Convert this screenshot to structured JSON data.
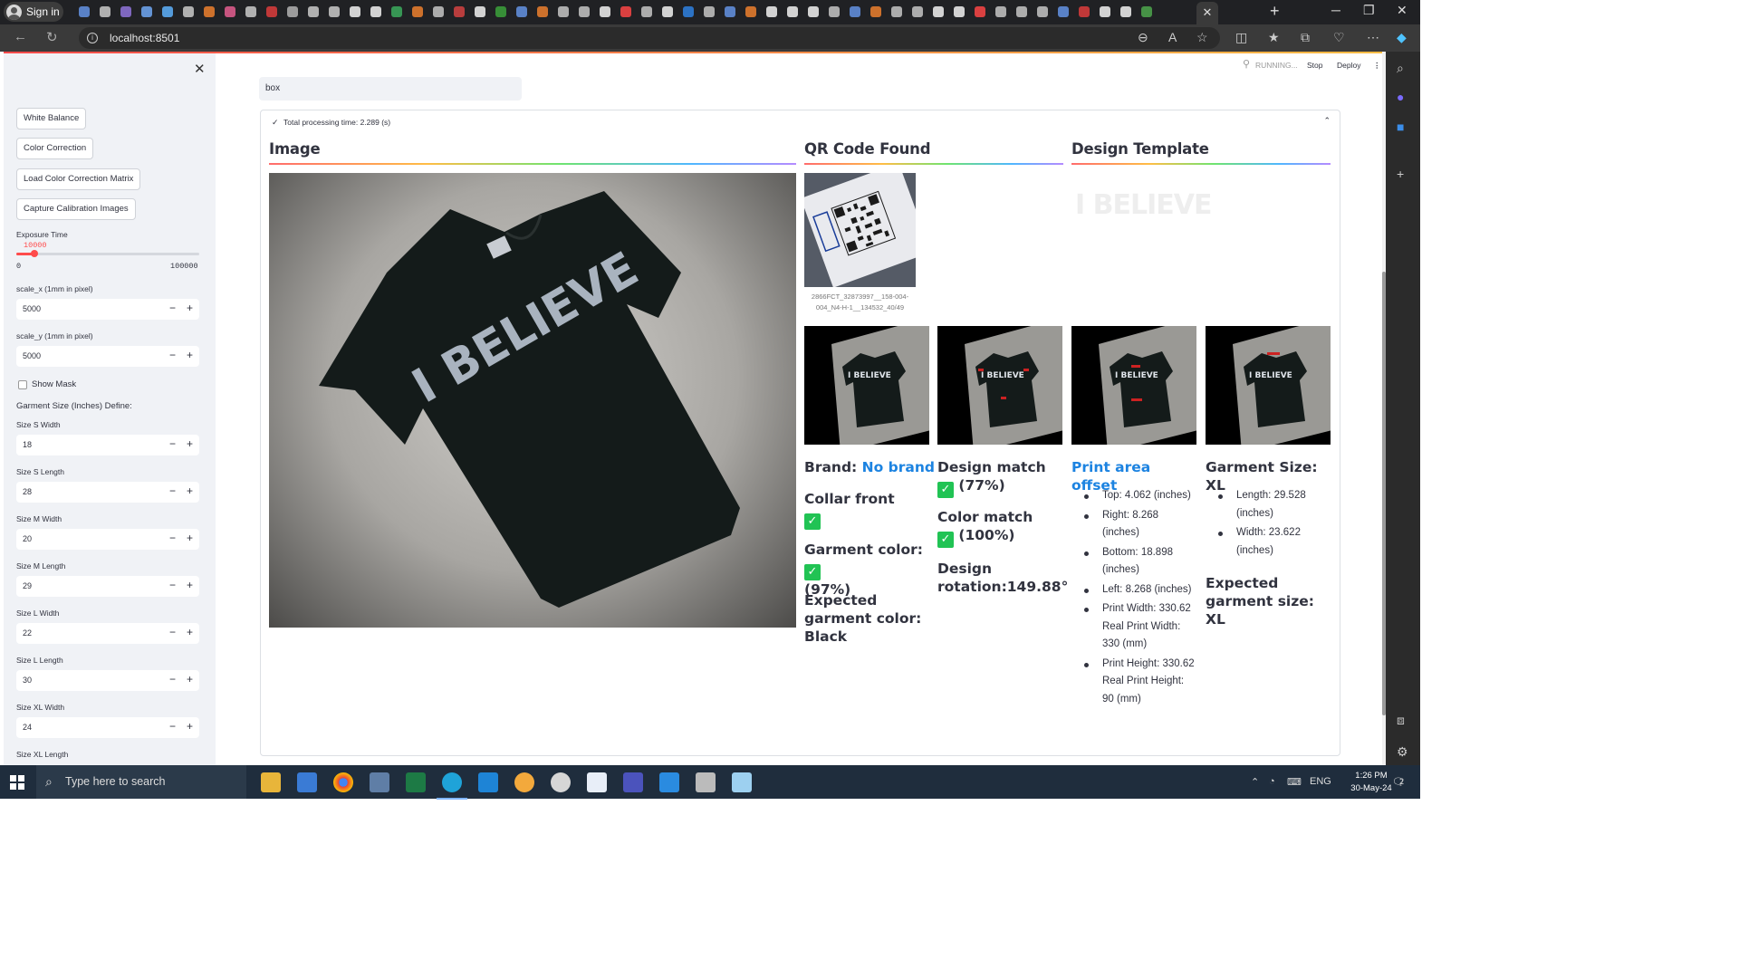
{
  "browser": {
    "signin_label": "Sign in",
    "url": "localhost:8501",
    "tab_close": "✕",
    "tab_icon_colors": [
      "#5f8cd8",
      "#c0c0c0",
      "#8a6fd0",
      "#6aa0e8",
      "#5aa9f0",
      "#c0c0c0",
      "#e07a2e",
      "#d85a8a",
      "#c0c0c0",
      "#d23b3b",
      "#aaa",
      "#c0c0c0",
      "#c0c0c0",
      "#e6e6e6",
      "#e6e6e6",
      "#3aa35a",
      "#e07a2e",
      "#bbb",
      "#c94040",
      "#e6e6e6",
      "#3a9a3a",
      "#5f8cd8",
      "#e07a2e",
      "#bbb",
      "#bbb",
      "#e6e6e6",
      "#e44",
      "#bbb",
      "#e6e6e6",
      "#2e7bd6",
      "#bbb",
      "#5f8cd8",
      "#e07a2e",
      "#e6e6e6",
      "#e6e6e6",
      "#e6e6e6",
      "#bbb",
      "#5f8cd8",
      "#e07a2e",
      "#bbb",
      "#bbb",
      "#e6e6e6",
      "#e6e6e6",
      "#e44",
      "#bbb",
      "#bbb",
      "#bbb",
      "#5f8cd8",
      "#d23b3b",
      "#e6e6e6",
      "#e6e6e6",
      "#4a9f4a"
    ]
  },
  "app": {
    "running_label": "RUNNING...",
    "stop_label": "Stop",
    "deploy_label": "Deploy",
    "box_input_value": "box",
    "processing_time": "Total processing time: 2.289 (s)"
  },
  "sidebar": {
    "buttons": [
      "White Balance",
      "Color Correction",
      "Load Color Correction Matrix",
      "Capture Calibration Images"
    ],
    "exposure": {
      "label": "Exposure Time",
      "value": "10000",
      "min": "0",
      "max": "100000",
      "fraction": 0.1
    },
    "scale_x": {
      "label": "scale_x (1mm in pixel)",
      "value": "5000"
    },
    "scale_y": {
      "label": "scale_y (1mm in pixel)",
      "value": "5000"
    },
    "show_mask": "Show Mask",
    "garment_define": "Garment Size (Inches) Define:",
    "sizes": [
      {
        "label": "Size S Width",
        "value": "18"
      },
      {
        "label": "Size S Length",
        "value": "28"
      },
      {
        "label": "Size M Width",
        "value": "20"
      },
      {
        "label": "Size M Length",
        "value": "29"
      },
      {
        "label": "Size L Width",
        "value": "22"
      },
      {
        "label": "Size L Length",
        "value": "30"
      },
      {
        "label": "Size XL Width",
        "value": "24"
      },
      {
        "label": "Size XL Length",
        "value": ""
      }
    ],
    "minus": "−",
    "plus": "+"
  },
  "main": {
    "image_header": "Image",
    "qr_header": "QR Code Found",
    "design_header": "Design Template",
    "qr_caption": "2866FCT_32873997__158-004-004_N4-H-1__134532_40/49",
    "design_logo_text": "I BELIEVE",
    "shirt_text": "I BELIEVE",
    "brand_label": "Brand: ",
    "brand_value": "No brand",
    "collar_label": "Collar front",
    "garment_color_label": "Garment color:",
    "garment_color_pct": "(97%)",
    "expected_color": "Expected garment color: Black",
    "design_match_label": "Design match",
    "design_match_pct": "(77%)",
    "color_match_label": "Color match",
    "color_match_pct": "(100%)",
    "design_rotation": "Design rotation:149.88°",
    "print_area_header": "Print area offset",
    "print_area_items": [
      "Top: 4.062 (inches)",
      "Right: 8.268 (inches)",
      "Bottom: 18.898 (inches)",
      "Left: 8.268 (inches)",
      "Print Width: 330.62 Real Print Width: 330 (mm)",
      "Print Height: 330.62 Real Print Height: 90 (mm)"
    ],
    "garment_size_header": "Garment Size: XL",
    "garment_size_items": [
      "Length: 29.528 (inches)",
      "Width: 23.622 (inches)"
    ],
    "expected_size": "Expected garment size: XL"
  },
  "taskbar": {
    "search_placeholder": "Type here to search",
    "language": "ENG",
    "time": "1:26 PM",
    "date": "30-May-24",
    "notification_count": "2"
  }
}
